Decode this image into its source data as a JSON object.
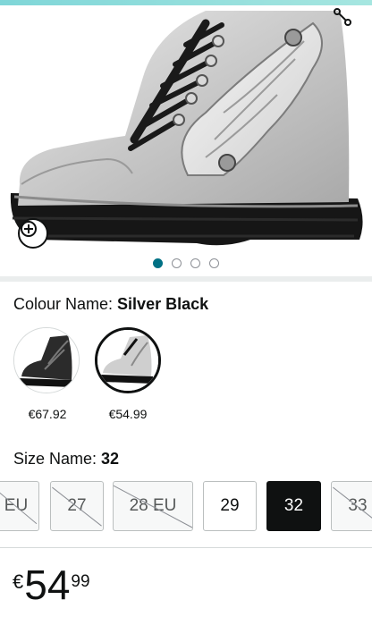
{
  "colors": {
    "accent": "#007185",
    "selected_bg": "#0f1111",
    "divider": "#eaeded"
  },
  "gallery": {
    "image_alt": "product-image-silver-winged-boot",
    "dots": [
      true,
      false,
      false,
      false
    ]
  },
  "icons": {
    "share": "share-icon",
    "zoom": "zoom-in-icon"
  },
  "colour": {
    "label": "Colour Name: ",
    "value": "Silver Black",
    "swatches": [
      {
        "price": "€67.92",
        "selected": false
      },
      {
        "price": "€54.99",
        "selected": true
      }
    ]
  },
  "size": {
    "label": "Size Name: ",
    "value": "32",
    "options": [
      {
        "label": "EU",
        "available": false,
        "selected": false
      },
      {
        "label": "27",
        "available": false,
        "selected": false
      },
      {
        "label": "28 EU",
        "available": false,
        "selected": false
      },
      {
        "label": "29",
        "available": true,
        "selected": false
      },
      {
        "label": "32",
        "available": true,
        "selected": true
      },
      {
        "label": "33",
        "available": false,
        "selected": false
      }
    ]
  },
  "price": {
    "currency": "€",
    "whole": "54",
    "fraction": "99"
  }
}
